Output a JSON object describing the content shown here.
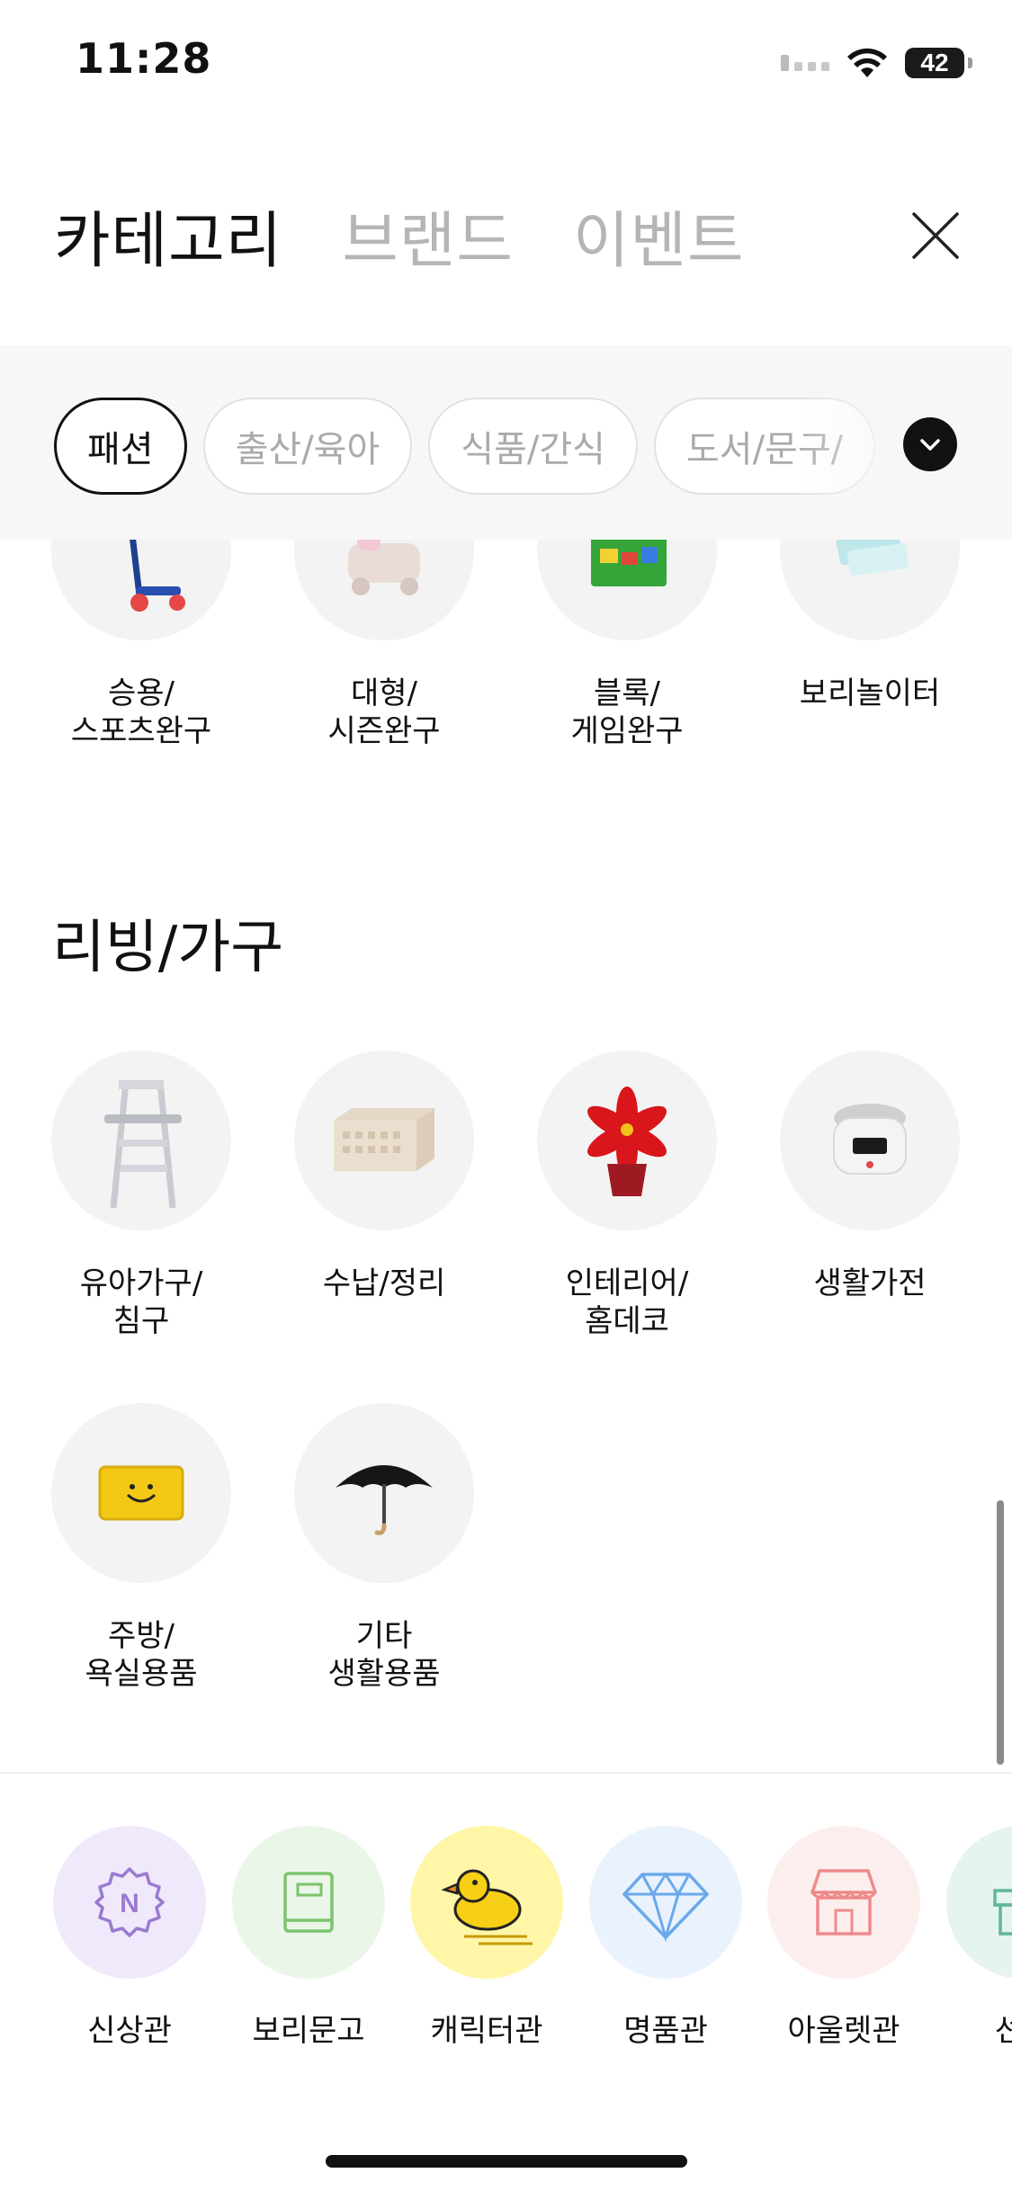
{
  "status_bar": {
    "time": "11:28",
    "battery": "42"
  },
  "top_tabs": [
    {
      "label": "카테고리",
      "active": true
    },
    {
      "label": "브랜드",
      "active": false
    },
    {
      "label": "이벤트",
      "active": false
    }
  ],
  "chips": [
    {
      "label": "패션",
      "active": true
    },
    {
      "label": "출산/육아",
      "active": false
    },
    {
      "label": "식품/간식",
      "active": false
    },
    {
      "label": "도서/문구/",
      "active": false
    }
  ],
  "toy_items": [
    {
      "label": "승용/\n스포츠완구",
      "icon": "scooter-icon"
    },
    {
      "label": "대형/\n시즌완구",
      "icon": "ride-on-toy-icon"
    },
    {
      "label": "블록/\n게임완구",
      "icon": "blocks-box-icon"
    },
    {
      "label": "보리놀이터",
      "icon": "ticket-icon"
    }
  ],
  "living_section": {
    "title": "리빙/가구",
    "items": [
      {
        "label": "유아가구/\n침구",
        "icon": "high-chair-icon"
      },
      {
        "label": "수납/정리",
        "icon": "storage-crate-icon"
      },
      {
        "label": "인테리어/\n홈데코",
        "icon": "poinsettia-plant-icon"
      },
      {
        "label": "생활가전",
        "icon": "rice-cooker-icon"
      },
      {
        "label": "주방/\n욕실용품",
        "icon": "smiley-tray-icon"
      },
      {
        "label": "기타\n생활용품",
        "icon": "umbrella-icon"
      }
    ]
  },
  "shops": [
    {
      "label": "신상관",
      "icon": "new-badge-icon",
      "bg": "#f0e9fb",
      "color": "#9a7bd0"
    },
    {
      "label": "보리문고",
      "icon": "book-icon",
      "bg": "#eaf6e8",
      "color": "#7cc36e"
    },
    {
      "label": "캐릭터관",
      "icon": "duck-icon",
      "bg": "#fff6a8",
      "color": "#e9b400"
    },
    {
      "label": "명품관",
      "icon": "diamond-icon",
      "bg": "#e9f2fd",
      "color": "#6aa9ea"
    },
    {
      "label": "아울렛관",
      "icon": "store-icon",
      "bg": "#fdeeee",
      "color": "#ee8a8a"
    },
    {
      "label": "선물",
      "icon": "gift-icon",
      "bg": "#e6f4ef",
      "color": "#5fb796"
    }
  ],
  "colors": {
    "accent": "#111111",
    "inactive_text": "#b5b5b5",
    "circle_bg": "#f3f3f3"
  }
}
